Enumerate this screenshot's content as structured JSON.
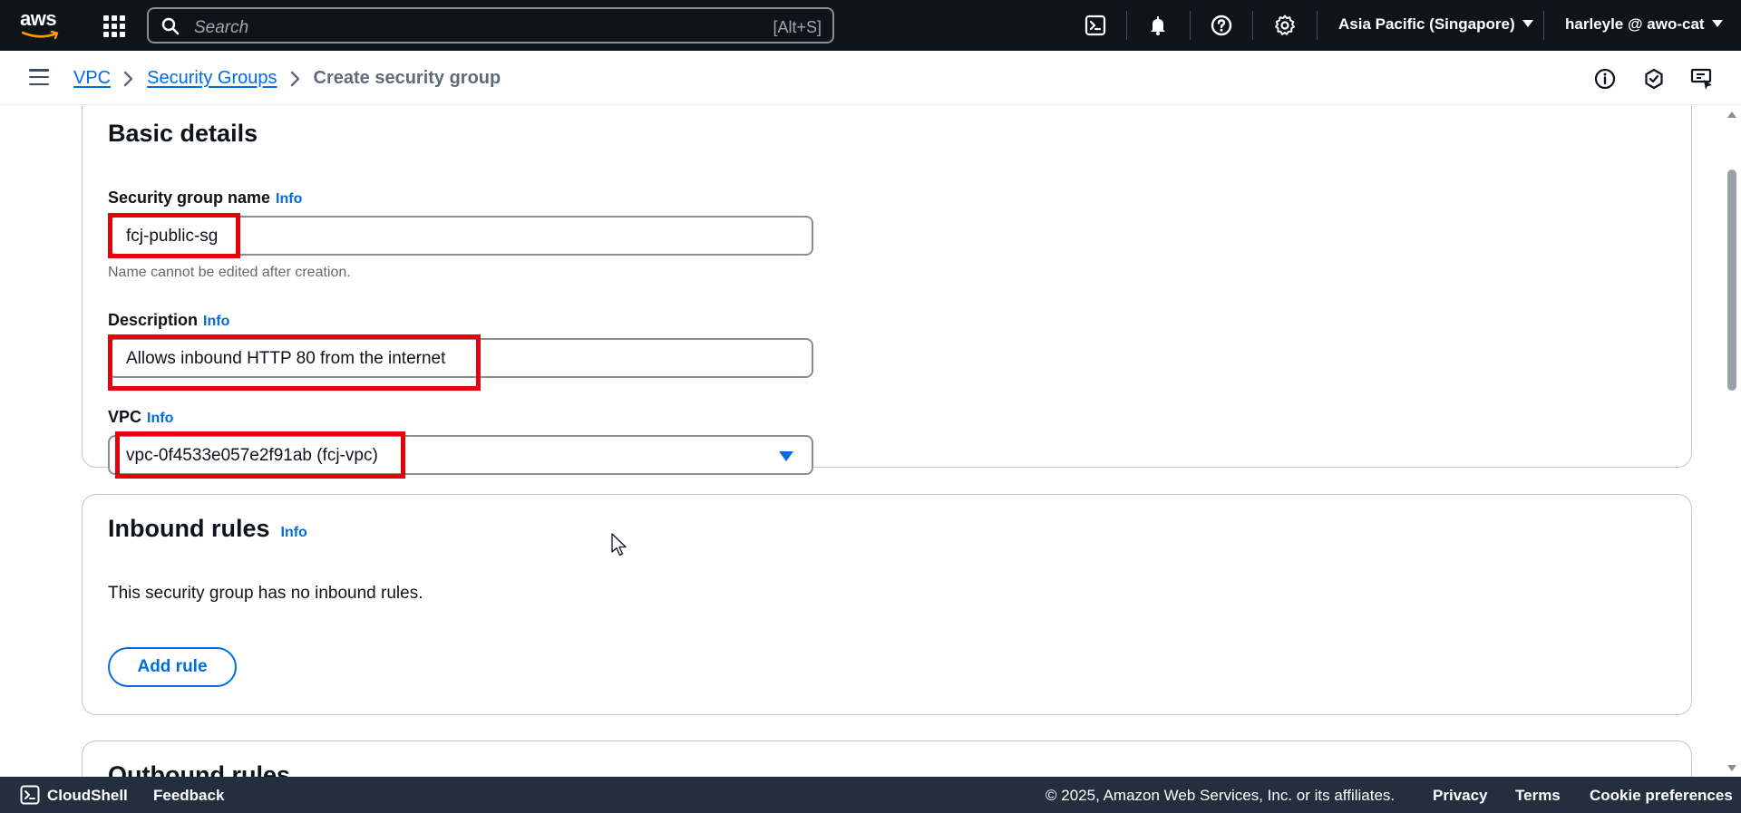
{
  "topnav": {
    "logo_text": "aws",
    "search_placeholder": "Search",
    "search_shortcut": "[Alt+S]",
    "region": "Asia Pacific (Singapore)",
    "user": "harleyle @ awo-cat",
    "icons": [
      "cloudshell-icon",
      "bell-icon",
      "help-icon",
      "gear-icon"
    ]
  },
  "breadcrumb": {
    "items": [
      "VPC",
      "Security Groups"
    ],
    "current": "Create security group"
  },
  "basic_details": {
    "title": "Basic details",
    "name_label": "Security group name",
    "name_info": "Info",
    "name_value": "fcj-public-sg",
    "name_hint": "Name cannot be edited after creation.",
    "description_label": "Description",
    "description_info": "Info",
    "description_value": "Allows inbound HTTP 80 from the internet",
    "vpc_label": "VPC",
    "vpc_info": "Info",
    "vpc_value": "vpc-0f4533e057e2f91ab (fcj-vpc)"
  },
  "inbound_rules": {
    "title": "Inbound rules",
    "info": "Info",
    "empty_text": "This security group has no inbound rules.",
    "add_rule_label": "Add rule"
  },
  "outbound_rules": {
    "title": "Outbound rules"
  },
  "footer": {
    "cloudshell": "CloudShell",
    "feedback": "Feedback",
    "copyright": "© 2025, Amazon Web Services, Inc. or its affiliates.",
    "privacy": "Privacy",
    "terms": "Terms",
    "cookies": "Cookie preferences"
  },
  "colors": {
    "nav_bg": "#0f141a",
    "footer_bg": "#232f3e",
    "link": "#006ce0",
    "highlight": "#e8000b"
  }
}
